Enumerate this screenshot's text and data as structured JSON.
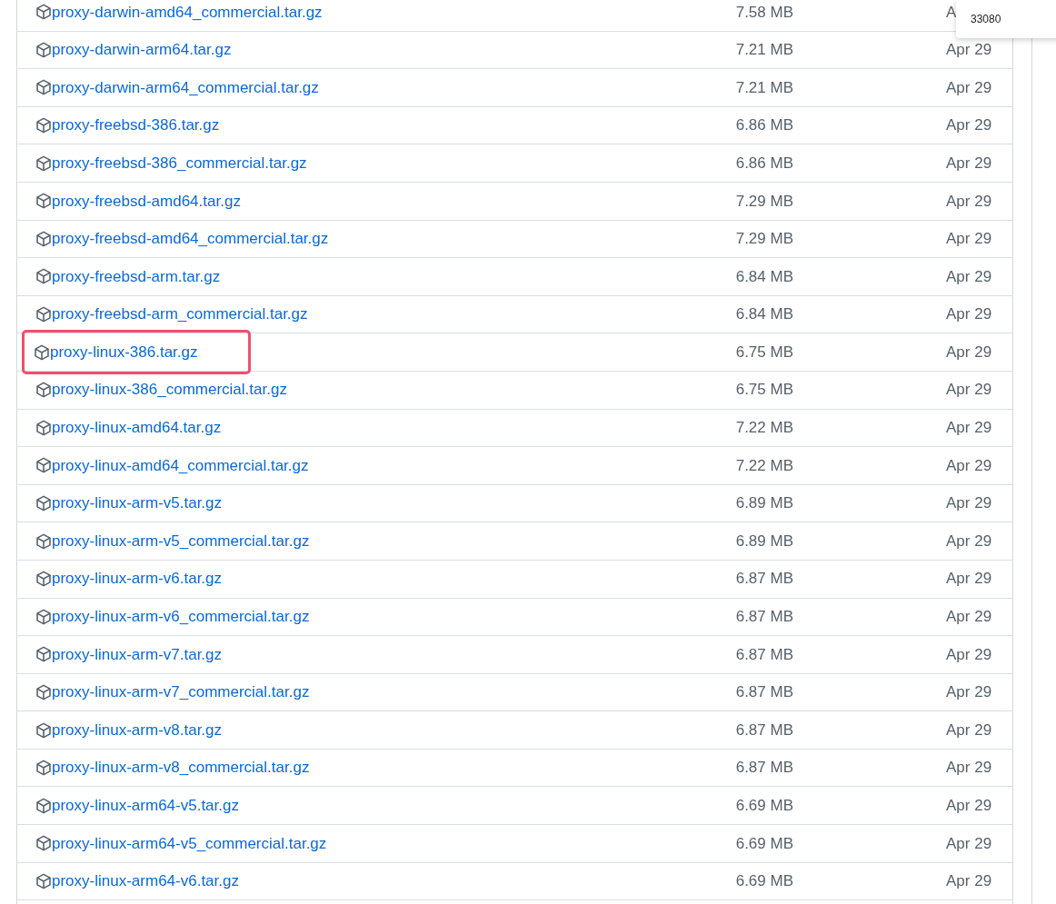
{
  "assets": [
    {
      "name": "proxy-darwin-amd64_commercial.tar.gz",
      "size": "7.58 MB",
      "date": "A",
      "highlighted": false
    },
    {
      "name": "proxy-darwin-arm64.tar.gz",
      "size": "7.21 MB",
      "date": "Apr 29",
      "highlighted": false
    },
    {
      "name": "proxy-darwin-arm64_commercial.tar.gz",
      "size": "7.21 MB",
      "date": "Apr 29",
      "highlighted": false
    },
    {
      "name": "proxy-freebsd-386.tar.gz",
      "size": "6.86 MB",
      "date": "Apr 29",
      "highlighted": false
    },
    {
      "name": "proxy-freebsd-386_commercial.tar.gz",
      "size": "6.86 MB",
      "date": "Apr 29",
      "highlighted": false
    },
    {
      "name": "proxy-freebsd-amd64.tar.gz",
      "size": "7.29 MB",
      "date": "Apr 29",
      "highlighted": false
    },
    {
      "name": "proxy-freebsd-amd64_commercial.tar.gz",
      "size": "7.29 MB",
      "date": "Apr 29",
      "highlighted": false
    },
    {
      "name": "proxy-freebsd-arm.tar.gz",
      "size": "6.84 MB",
      "date": "Apr 29",
      "highlighted": false
    },
    {
      "name": "proxy-freebsd-arm_commercial.tar.gz",
      "size": "6.84 MB",
      "date": "Apr 29",
      "highlighted": false
    },
    {
      "name": "proxy-linux-386.tar.gz",
      "size": "6.75 MB",
      "date": "Apr 29",
      "highlighted": true
    },
    {
      "name": "proxy-linux-386_commercial.tar.gz",
      "size": "6.75 MB",
      "date": "Apr 29",
      "highlighted": false
    },
    {
      "name": "proxy-linux-amd64.tar.gz",
      "size": "7.22 MB",
      "date": "Apr 29",
      "highlighted": false
    },
    {
      "name": "proxy-linux-amd64_commercial.tar.gz",
      "size": "7.22 MB",
      "date": "Apr 29",
      "highlighted": false
    },
    {
      "name": "proxy-linux-arm-v5.tar.gz",
      "size": "6.89 MB",
      "date": "Apr 29",
      "highlighted": false
    },
    {
      "name": "proxy-linux-arm-v5_commercial.tar.gz",
      "size": "6.89 MB",
      "date": "Apr 29",
      "highlighted": false
    },
    {
      "name": "proxy-linux-arm-v6.tar.gz",
      "size": "6.87 MB",
      "date": "Apr 29",
      "highlighted": false
    },
    {
      "name": "proxy-linux-arm-v6_commercial.tar.gz",
      "size": "6.87 MB",
      "date": "Apr 29",
      "highlighted": false
    },
    {
      "name": "proxy-linux-arm-v7.tar.gz",
      "size": "6.87 MB",
      "date": "Apr 29",
      "highlighted": false
    },
    {
      "name": "proxy-linux-arm-v7_commercial.tar.gz",
      "size": "6.87 MB",
      "date": "Apr 29",
      "highlighted": false
    },
    {
      "name": "proxy-linux-arm-v8.tar.gz",
      "size": "6.87 MB",
      "date": "Apr 29",
      "highlighted": false
    },
    {
      "name": "proxy-linux-arm-v8_commercial.tar.gz",
      "size": "6.87 MB",
      "date": "Apr 29",
      "highlighted": false
    },
    {
      "name": "proxy-linux-arm64-v5.tar.gz",
      "size": "6.69 MB",
      "date": "Apr 29",
      "highlighted": false
    },
    {
      "name": "proxy-linux-arm64-v5_commercial.tar.gz",
      "size": "6.69 MB",
      "date": "Apr 29",
      "highlighted": false
    },
    {
      "name": "proxy-linux-arm64-v6.tar.gz",
      "size": "6.69 MB",
      "date": "Apr 29",
      "highlighted": false
    }
  ],
  "popup": {
    "text": "33080"
  }
}
